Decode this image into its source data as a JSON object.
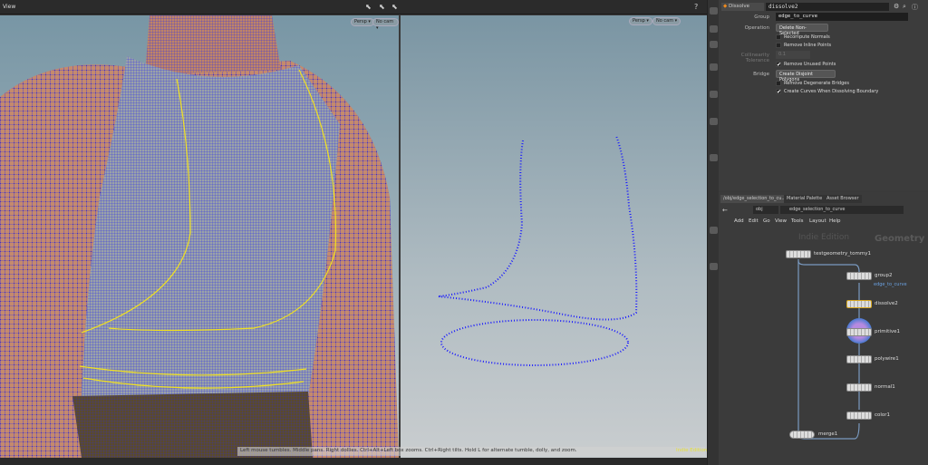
{
  "viewer": {
    "title": "View",
    "left_cam": {
      "persp": "Persp ▾",
      "cam": "No cam ▾"
    },
    "right_cam": {
      "persp": "Persp ▾",
      "cam": "No cam ▾"
    },
    "status": "Left mouse tumbles. Middle pans. Right dollies. Ctrl+Alt+Left box zooms. Ctrl+Right tilts. Hold L for alternate tumble, dolly, and zoom.",
    "edition_badge": "Indie Edition"
  },
  "params": {
    "node_type": "Dissolve",
    "node_name": "dissolve2",
    "group_label": "Group",
    "group_value": "edge_to_curve",
    "operation_label": "Operation",
    "operation_value": "Delete Non-Selected",
    "recompute_normals": {
      "label": "Recompute Normals",
      "checked": false
    },
    "remove_inline": {
      "label": "Remove Inline Points",
      "checked": false
    },
    "collinearity_label": "Collinearity Tolerance",
    "collinearity_value": "0.1",
    "remove_unused": {
      "label": "Remove Unused Points",
      "checked": true
    },
    "bridge_label": "Bridge",
    "bridge_value": "Create Disjoint Polygons",
    "remove_degenerate": {
      "label": "Remove Degenerate Bridges",
      "checked": false
    },
    "create_curves": {
      "label": "Create Curves When Dissolving Boundary",
      "checked": true
    },
    "check_mark": "✔"
  },
  "network": {
    "tabs": [
      "/obj/edge_selection_to_cu...",
      "Material Palette",
      "Asset Browser"
    ],
    "path_root": "obj",
    "path_node": "edge_selection_to_curve",
    "menu": [
      "Add",
      "Edit",
      "Go",
      "View",
      "Tools",
      "Layout",
      "Help"
    ],
    "watermark": "Indie Edition",
    "context": "Geometry",
    "nodes": [
      {
        "name": "testgeometry_tommy1"
      },
      {
        "name": "group2",
        "sub": "edge_to_curve"
      },
      {
        "name": "dissolve2"
      },
      {
        "name": "primitive1"
      },
      {
        "name": "polywire1"
      },
      {
        "name": "normal1"
      },
      {
        "name": "color1"
      },
      {
        "name": "merge1"
      }
    ]
  },
  "colors": {
    "mesh": "#1a1aff",
    "selection": "#f0e020",
    "skin": "#c98a6a",
    "accent": "#f08a1c"
  }
}
